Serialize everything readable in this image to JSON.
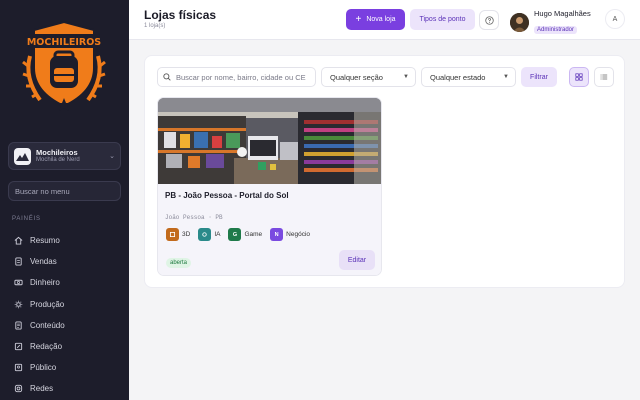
{
  "sidebar": {
    "logo_text": "MOCHILEIROS",
    "org": {
      "name": "Mochileiros",
      "subtitle": "Mochila de Nerd"
    },
    "search_placeholder": "Buscar no menu",
    "section_label": "PAINÉIS",
    "items": [
      {
        "label": "Resumo",
        "icon": "home-icon"
      },
      {
        "label": "Vendas",
        "icon": "document-icon"
      },
      {
        "label": "Dinheiro",
        "icon": "money-icon"
      },
      {
        "label": "Produção",
        "icon": "settings-icon"
      },
      {
        "label": "Conteúdo",
        "icon": "content-icon"
      },
      {
        "label": "Redação",
        "icon": "edit-icon"
      },
      {
        "label": "Público",
        "icon": "users-icon"
      },
      {
        "label": "Redes",
        "icon": "instagram-icon"
      }
    ]
  },
  "header": {
    "title": "Lojas físicas",
    "subtitle": "1 loja(s)",
    "new_store_label": "Nova loja",
    "point_types_label": "Tipos de ponto",
    "user_name": "Hugo Magalhães",
    "user_role": "Administrador",
    "user_menu_label": "A"
  },
  "filters": {
    "search_placeholder": "Buscar por nome, bairro, cidade ou CEP",
    "section_select": "Qualquer seção",
    "state_select": "Qualquer estado",
    "filter_label": "Filtrar"
  },
  "stores": [
    {
      "title": "PB - João Pessoa - Portal do Sol",
      "location": "João Pessoa · PB",
      "tags": [
        {
          "label": "3D",
          "icon_text": "",
          "color": "#c26a1c"
        },
        {
          "label": "IA",
          "icon_text": "",
          "color": "#2a8a8a"
        },
        {
          "label": "Game",
          "icon_text": "G",
          "color": "#1f7a4a"
        },
        {
          "label": "Negócio",
          "icon_text": "N",
          "color": "#7a4ae0"
        }
      ],
      "status": "aberta",
      "edit_label": "Editar"
    }
  ],
  "colors": {
    "accent": "#7a3fe0",
    "accent_soft": "#ece4fb",
    "sidebar_bg": "#1d1d2b",
    "logo_orange": "#f07c1a"
  }
}
